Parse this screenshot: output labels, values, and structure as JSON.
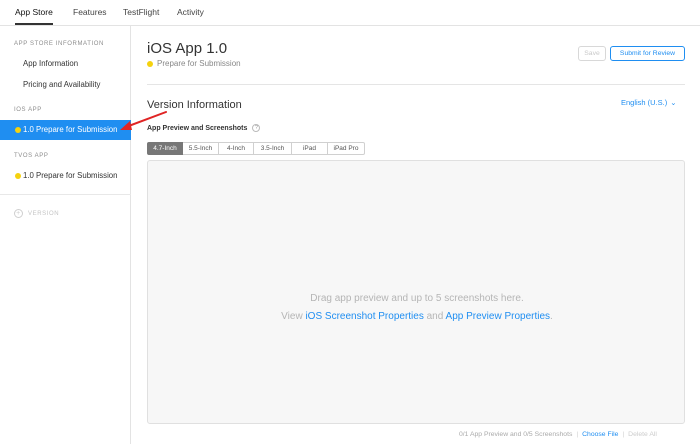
{
  "topnav": {
    "tabs": [
      {
        "label": "App Store",
        "active": true
      },
      {
        "label": "Features",
        "active": false
      },
      {
        "label": "TestFlight",
        "active": false
      },
      {
        "label": "Activity",
        "active": false
      }
    ]
  },
  "sidebar": {
    "app_store_info_heading": "APP STORE INFORMATION",
    "app_information": "App Information",
    "pricing_availability": "Pricing and Availability",
    "ios_heading": "iOS APP",
    "ios_version_item": "1.0 Prepare for Submission",
    "tvos_heading": "tvOS APP",
    "tvos_version_item": "1.0 Prepare for Submission",
    "version_label": "VERSION",
    "version_plus": "+"
  },
  "main": {
    "app_title": "iOS App 1.0",
    "status": "Prepare for Submission",
    "save_label": "Save",
    "submit_label": "Submit for Review",
    "version_info_title": "Version Information",
    "language": "English (U.S.)",
    "language_chevron": "⌄",
    "preview_title": "App Preview and Screenshots",
    "help_glyph": "?",
    "device_tabs": [
      "4.7-Inch",
      "5.5-Inch",
      "4-Inch",
      "3.5-Inch",
      "iPad",
      "iPad Pro"
    ],
    "active_device_tab": "4.7-Inch",
    "dropzone_line1": "Drag app preview and up to 5 screenshots here.",
    "dropzone_view": "View",
    "dropzone_link1": "iOS Screenshot Properties",
    "dropzone_and": "and",
    "dropzone_link2": "App Preview Properties",
    "dropzone_period": ".",
    "footer_count": "0/1 App Preview and 0/5 Screenshots",
    "footer_sep": "|",
    "choose_file": "Choose File",
    "delete_all": "Delete All"
  },
  "colors": {
    "accent": "#1f8ef1",
    "status_dot": "#f5d20e",
    "annotation_arrow": "#e02424"
  }
}
